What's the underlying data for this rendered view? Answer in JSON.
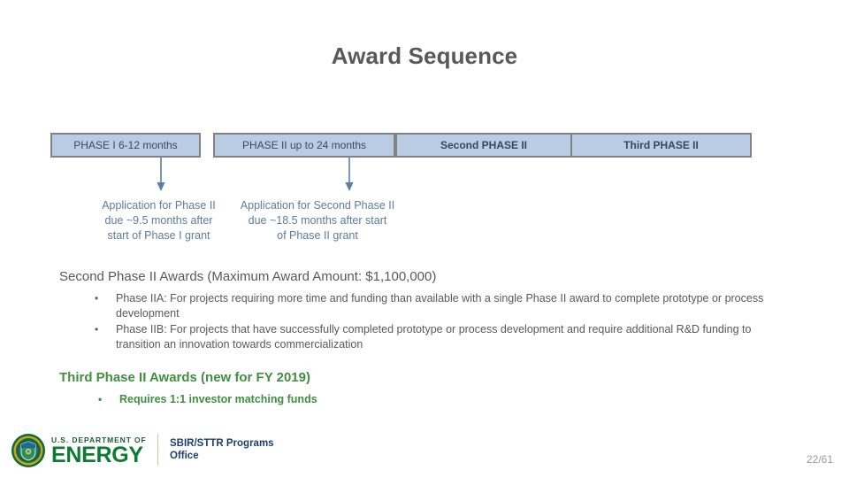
{
  "slide": {
    "title": "Award Sequence",
    "page_number": "22/61"
  },
  "phase_bar": {
    "boxes": [
      {
        "label": "PHASE I  6-12 months"
      },
      {
        "label": "PHASE II  up to 24 months"
      },
      {
        "label": "Second PHASE II"
      },
      {
        "label": "Third PHASE II"
      }
    ],
    "fill_color": "#b9cce4",
    "border_color": "#808285"
  },
  "arrow_captions": [
    {
      "line1": "Application for Phase II",
      "line2": "due ~9.5 months after",
      "line3": "start of Phase I grant"
    },
    {
      "line1": "Application for Second Phase II",
      "line2": "due ~18.5 months after start",
      "line3": "of Phase II grant"
    }
  ],
  "second_phase": {
    "heading": "Second Phase II Awards (Maximum Award Amount:  $1,100,000)",
    "bullet_glyph": "•",
    "bullets": [
      "Phase IIA:  For projects requiring more time and funding than available with a single Phase II award to complete prototype or process development",
      "Phase IIB: For projects that have successfully completed prototype or process development and require additional R&D funding to transition an innovation towards commercialization"
    ]
  },
  "third_phase": {
    "heading": "Third Phase II Awards (new for FY 2019)",
    "bullet_glyph": "•",
    "bullets": [
      "Requires 1:1 investor matching funds"
    ],
    "color": "#3f8f3f"
  },
  "footer": {
    "logo": {
      "dept_line": "U.S. DEPARTMENT OF",
      "energy_line": "ENERGY"
    },
    "program_line1": "SBIR/STTR Programs",
    "program_line2": "Office"
  }
}
